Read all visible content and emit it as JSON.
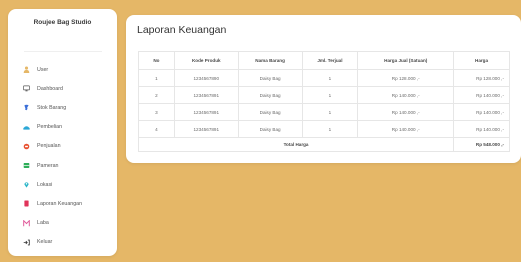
{
  "sidebar": {
    "brand": "Roujee Bag Studio",
    "items": [
      {
        "label": "User",
        "icon": "user-icon",
        "color": "#e5b767"
      },
      {
        "label": "Dashboard",
        "icon": "monitor-icon",
        "color": "#555555"
      },
      {
        "label": "Stok Barang",
        "icon": "stock-icon",
        "color": "#3b6fd8"
      },
      {
        "label": "Pembelian",
        "icon": "cart-icon",
        "color": "#2aa7d6"
      },
      {
        "label": "Penjualan",
        "icon": "sales-icon",
        "color": "#e8502f"
      },
      {
        "label": "Pameran",
        "icon": "exhibition-icon",
        "color": "#2fae5a"
      },
      {
        "label": "Lokasi",
        "icon": "location-icon",
        "color": "#2bb5c8"
      },
      {
        "label": "Laporan Keuangan",
        "icon": "report-icon",
        "color": "#e0345a"
      },
      {
        "label": "Laba",
        "icon": "profit-icon",
        "color": "#e05a9a"
      },
      {
        "label": "Keluar",
        "icon": "logout-icon",
        "color": "#333333"
      }
    ]
  },
  "main": {
    "title": "Laporan Keuangan",
    "table": {
      "headers": [
        "No",
        "Kode Produk",
        "Nama Barang",
        "Jml. Terjual",
        "Harga Jual (Satuan)",
        "Harga"
      ],
      "rows": [
        [
          "1",
          "1234567890",
          "Daisy Bag",
          "1",
          "Rp 128.000 ,-",
          "Rp 128.000 ,-"
        ],
        [
          "2",
          "1234567891",
          "Daisy Bag",
          "1",
          "Rp 140.000 ,-",
          "Rp 140.000 ,-"
        ],
        [
          "3",
          "1234567891",
          "Daisy Bag",
          "1",
          "Rp 140.000 ,-",
          "Rp 140.000 ,-"
        ],
        [
          "4",
          "1234567891",
          "Daisy Bag",
          "1",
          "Rp 140.000 ,-",
          "Rp 140.000 ,-"
        ]
      ],
      "total_label": "Total Harga",
      "total_value": "Rp 548.000 ,-"
    }
  },
  "colors": {
    "background": "#e5b767",
    "card": "#ffffff"
  }
}
